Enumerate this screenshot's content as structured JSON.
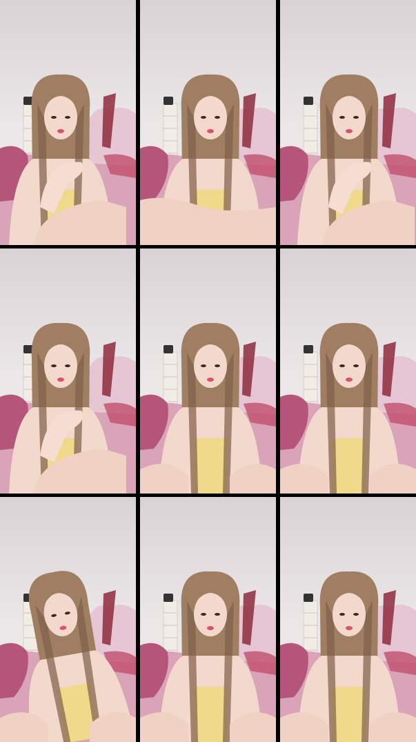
{
  "gallery": {
    "layout": "3x3",
    "frame_count": 9,
    "frames": [
      {
        "pose": "foot-raised-left"
      },
      {
        "pose": "foot-held-low"
      },
      {
        "pose": "foot-raised-left"
      },
      {
        "pose": "foot-raised-left"
      },
      {
        "pose": "seated-straight"
      },
      {
        "pose": "seated-straight"
      },
      {
        "pose": "seated-head-tilt"
      },
      {
        "pose": "seated-straight"
      },
      {
        "pose": "seated-straight"
      }
    ]
  },
  "colors": {
    "border": "#000000",
    "wall": "#ebe6e8",
    "hair": "#a07e62",
    "hair_shade": "#7e5f48",
    "skin": "#f3d8cc",
    "top": "#f0d98a",
    "bedding_pink": "#d9a3b8",
    "blanket_magenta": "#b5557a",
    "headboard": "#e6c6d3",
    "shelf": "#f1ece6"
  }
}
